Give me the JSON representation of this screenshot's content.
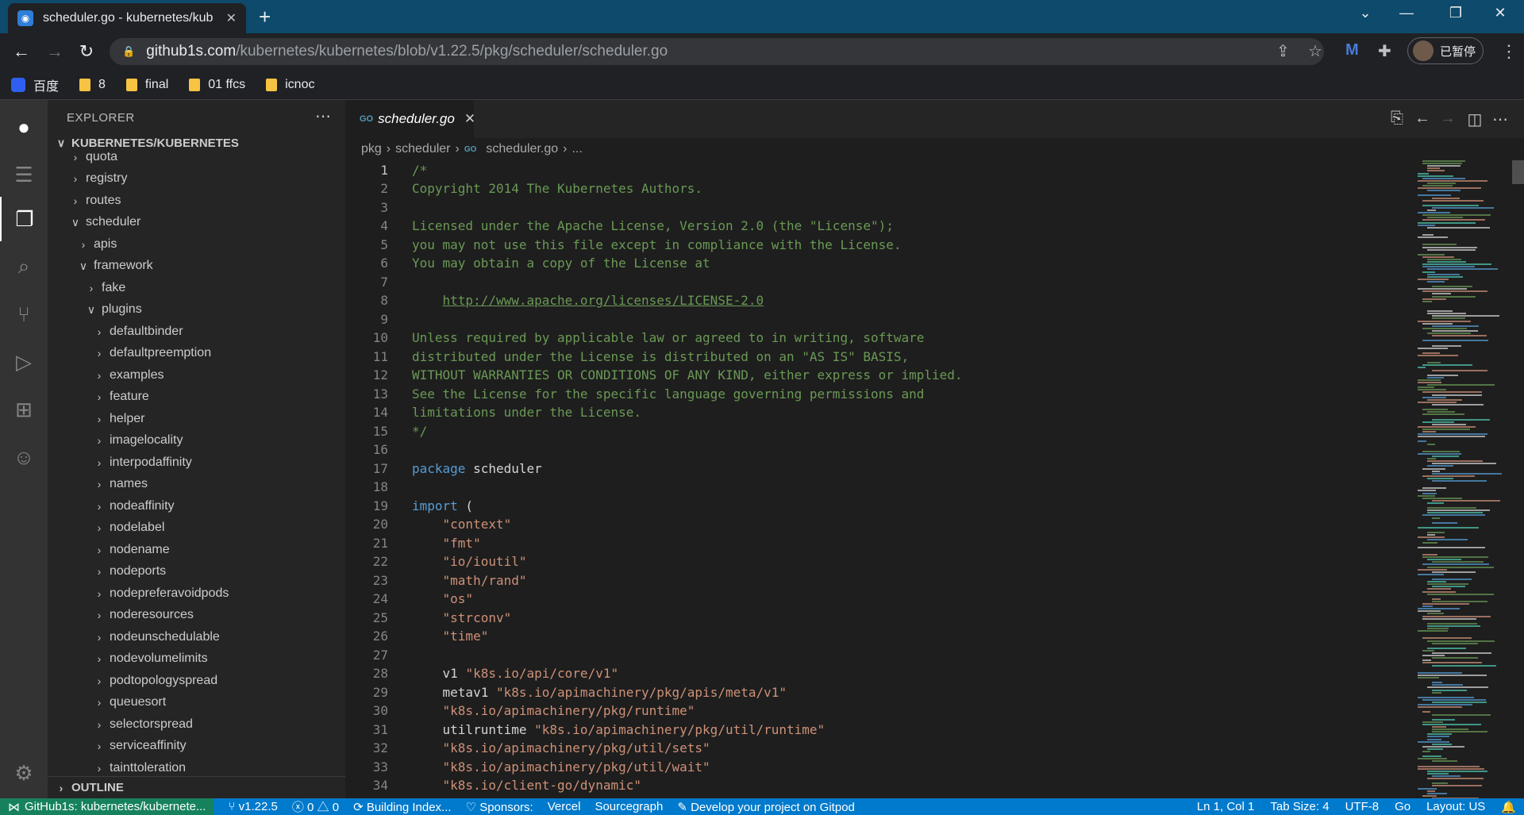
{
  "browser": {
    "tab_title": "scheduler.go - kubernetes/kub",
    "url_host": "github1s.com",
    "url_path": "/kubernetes/kubernetes/blob/v1.22.5/pkg/scheduler/scheduler.go",
    "profile_label": "已暂停",
    "bookmarks": [
      "百度",
      "8",
      "final",
      "01 ffcs",
      "icnoc"
    ]
  },
  "sidebar": {
    "title": "EXPLORER",
    "section": "KUBERNETES/KUBERNETES",
    "outline": "OUTLINE",
    "tree": [
      {
        "label": "quota",
        "depth": 0,
        "open": false,
        "partial": true
      },
      {
        "label": "registry",
        "depth": 0,
        "open": false
      },
      {
        "label": "routes",
        "depth": 0,
        "open": false
      },
      {
        "label": "scheduler",
        "depth": 0,
        "open": true
      },
      {
        "label": "apis",
        "depth": 1,
        "open": false
      },
      {
        "label": "framework",
        "depth": 1,
        "open": true
      },
      {
        "label": "fake",
        "depth": 2,
        "open": false
      },
      {
        "label": "plugins",
        "depth": 2,
        "open": true
      },
      {
        "label": "defaultbinder",
        "depth": 3,
        "open": false
      },
      {
        "label": "defaultpreemption",
        "depth": 3,
        "open": false
      },
      {
        "label": "examples",
        "depth": 3,
        "open": false
      },
      {
        "label": "feature",
        "depth": 3,
        "open": false
      },
      {
        "label": "helper",
        "depth": 3,
        "open": false
      },
      {
        "label": "imagelocality",
        "depth": 3,
        "open": false
      },
      {
        "label": "interpodaffinity",
        "depth": 3,
        "open": false
      },
      {
        "label": "names",
        "depth": 3,
        "open": false
      },
      {
        "label": "nodeaffinity",
        "depth": 3,
        "open": false
      },
      {
        "label": "nodelabel",
        "depth": 3,
        "open": false
      },
      {
        "label": "nodename",
        "depth": 3,
        "open": false
      },
      {
        "label": "nodeports",
        "depth": 3,
        "open": false
      },
      {
        "label": "nodepreferavoidpods",
        "depth": 3,
        "open": false
      },
      {
        "label": "noderesources",
        "depth": 3,
        "open": false
      },
      {
        "label": "nodeunschedulable",
        "depth": 3,
        "open": false
      },
      {
        "label": "nodevolumelimits",
        "depth": 3,
        "open": false
      },
      {
        "label": "podtopologyspread",
        "depth": 3,
        "open": false
      },
      {
        "label": "queuesort",
        "depth": 3,
        "open": false
      },
      {
        "label": "selectorspread",
        "depth": 3,
        "open": false
      },
      {
        "label": "serviceaffinity",
        "depth": 3,
        "open": false
      },
      {
        "label": "tainttoleration",
        "depth": 3,
        "open": false
      }
    ]
  },
  "editor": {
    "tab_label": "scheduler.go",
    "tab_lang": "GO",
    "breadcrumb": [
      "pkg",
      "scheduler",
      "scheduler.go",
      "..."
    ],
    "current_line": 1,
    "colors": {
      "comment": "#6a9955",
      "keyword": "#569cd6",
      "string": "#ce9178",
      "text": "#d4d4d4"
    },
    "lines": [
      [
        [
          "c",
          "/*"
        ]
      ],
      [
        [
          "c",
          "Copyright 2014 The Kubernetes Authors."
        ]
      ],
      [],
      [
        [
          "c",
          "Licensed under the Apache License, Version 2.0 (the \"License\");"
        ]
      ],
      [
        [
          "c",
          "you may not use this file except in compliance with the License."
        ]
      ],
      [
        [
          "c",
          "You may obtain a copy of the License at"
        ]
      ],
      [],
      [
        [
          "c",
          "    "
        ],
        [
          "u",
          "http://www.apache.org/licenses/LICENSE-2.0"
        ]
      ],
      [],
      [
        [
          "c",
          "Unless required by applicable law or agreed to in writing, software"
        ]
      ],
      [
        [
          "c",
          "distributed under the License is distributed on an \"AS IS\" BASIS,"
        ]
      ],
      [
        [
          "c",
          "WITHOUT WARRANTIES OR CONDITIONS OF ANY KIND, either express or implied."
        ]
      ],
      [
        [
          "c",
          "See the License for the specific language governing permissions and"
        ]
      ],
      [
        [
          "c",
          "limitations under the License."
        ]
      ],
      [
        [
          "c",
          "*/"
        ]
      ],
      [],
      [
        [
          "k",
          "package"
        ],
        [
          "t",
          " scheduler"
        ]
      ],
      [],
      [
        [
          "k",
          "import"
        ],
        [
          "t",
          " ("
        ]
      ],
      [
        [
          "t",
          "    "
        ],
        [
          "s",
          "\"context\""
        ]
      ],
      [
        [
          "t",
          "    "
        ],
        [
          "s",
          "\"fmt\""
        ]
      ],
      [
        [
          "t",
          "    "
        ],
        [
          "s",
          "\"io/ioutil\""
        ]
      ],
      [
        [
          "t",
          "    "
        ],
        [
          "s",
          "\"math/rand\""
        ]
      ],
      [
        [
          "t",
          "    "
        ],
        [
          "s",
          "\"os\""
        ]
      ],
      [
        [
          "t",
          "    "
        ],
        [
          "s",
          "\"strconv\""
        ]
      ],
      [
        [
          "t",
          "    "
        ],
        [
          "s",
          "\"time\""
        ]
      ],
      [],
      [
        [
          "t",
          "    v1 "
        ],
        [
          "s",
          "\"k8s.io/api/core/v1\""
        ]
      ],
      [
        [
          "t",
          "    metav1 "
        ],
        [
          "s",
          "\"k8s.io/apimachinery/pkg/apis/meta/v1\""
        ]
      ],
      [
        [
          "t",
          "    "
        ],
        [
          "s",
          "\"k8s.io/apimachinery/pkg/runtime\""
        ]
      ],
      [
        [
          "t",
          "    utilruntime "
        ],
        [
          "s",
          "\"k8s.io/apimachinery/pkg/util/runtime\""
        ]
      ],
      [
        [
          "t",
          "    "
        ],
        [
          "s",
          "\"k8s.io/apimachinery/pkg/util/sets\""
        ]
      ],
      [
        [
          "t",
          "    "
        ],
        [
          "s",
          "\"k8s.io/apimachinery/pkg/util/wait\""
        ]
      ],
      [
        [
          "t",
          "    "
        ],
        [
          "s",
          "\"k8s.io/client-go/dynamic\""
        ]
      ]
    ]
  },
  "statusbar": {
    "remote": "GitHub1s: kubernetes/kubernete...",
    "branch": "v1.22.5",
    "problems": "0 △ 0",
    "building": "Building Index...",
    "sponsors": "Sponsors:",
    "vercel": "Vercel",
    "sourcegraph": "Sourcegraph",
    "gitpod": "Develop your project on Gitpod",
    "position": "Ln 1, Col 1",
    "tabsize": "Tab Size: 4",
    "encoding": "UTF-8",
    "language": "Go",
    "layout": "Layout: US"
  }
}
